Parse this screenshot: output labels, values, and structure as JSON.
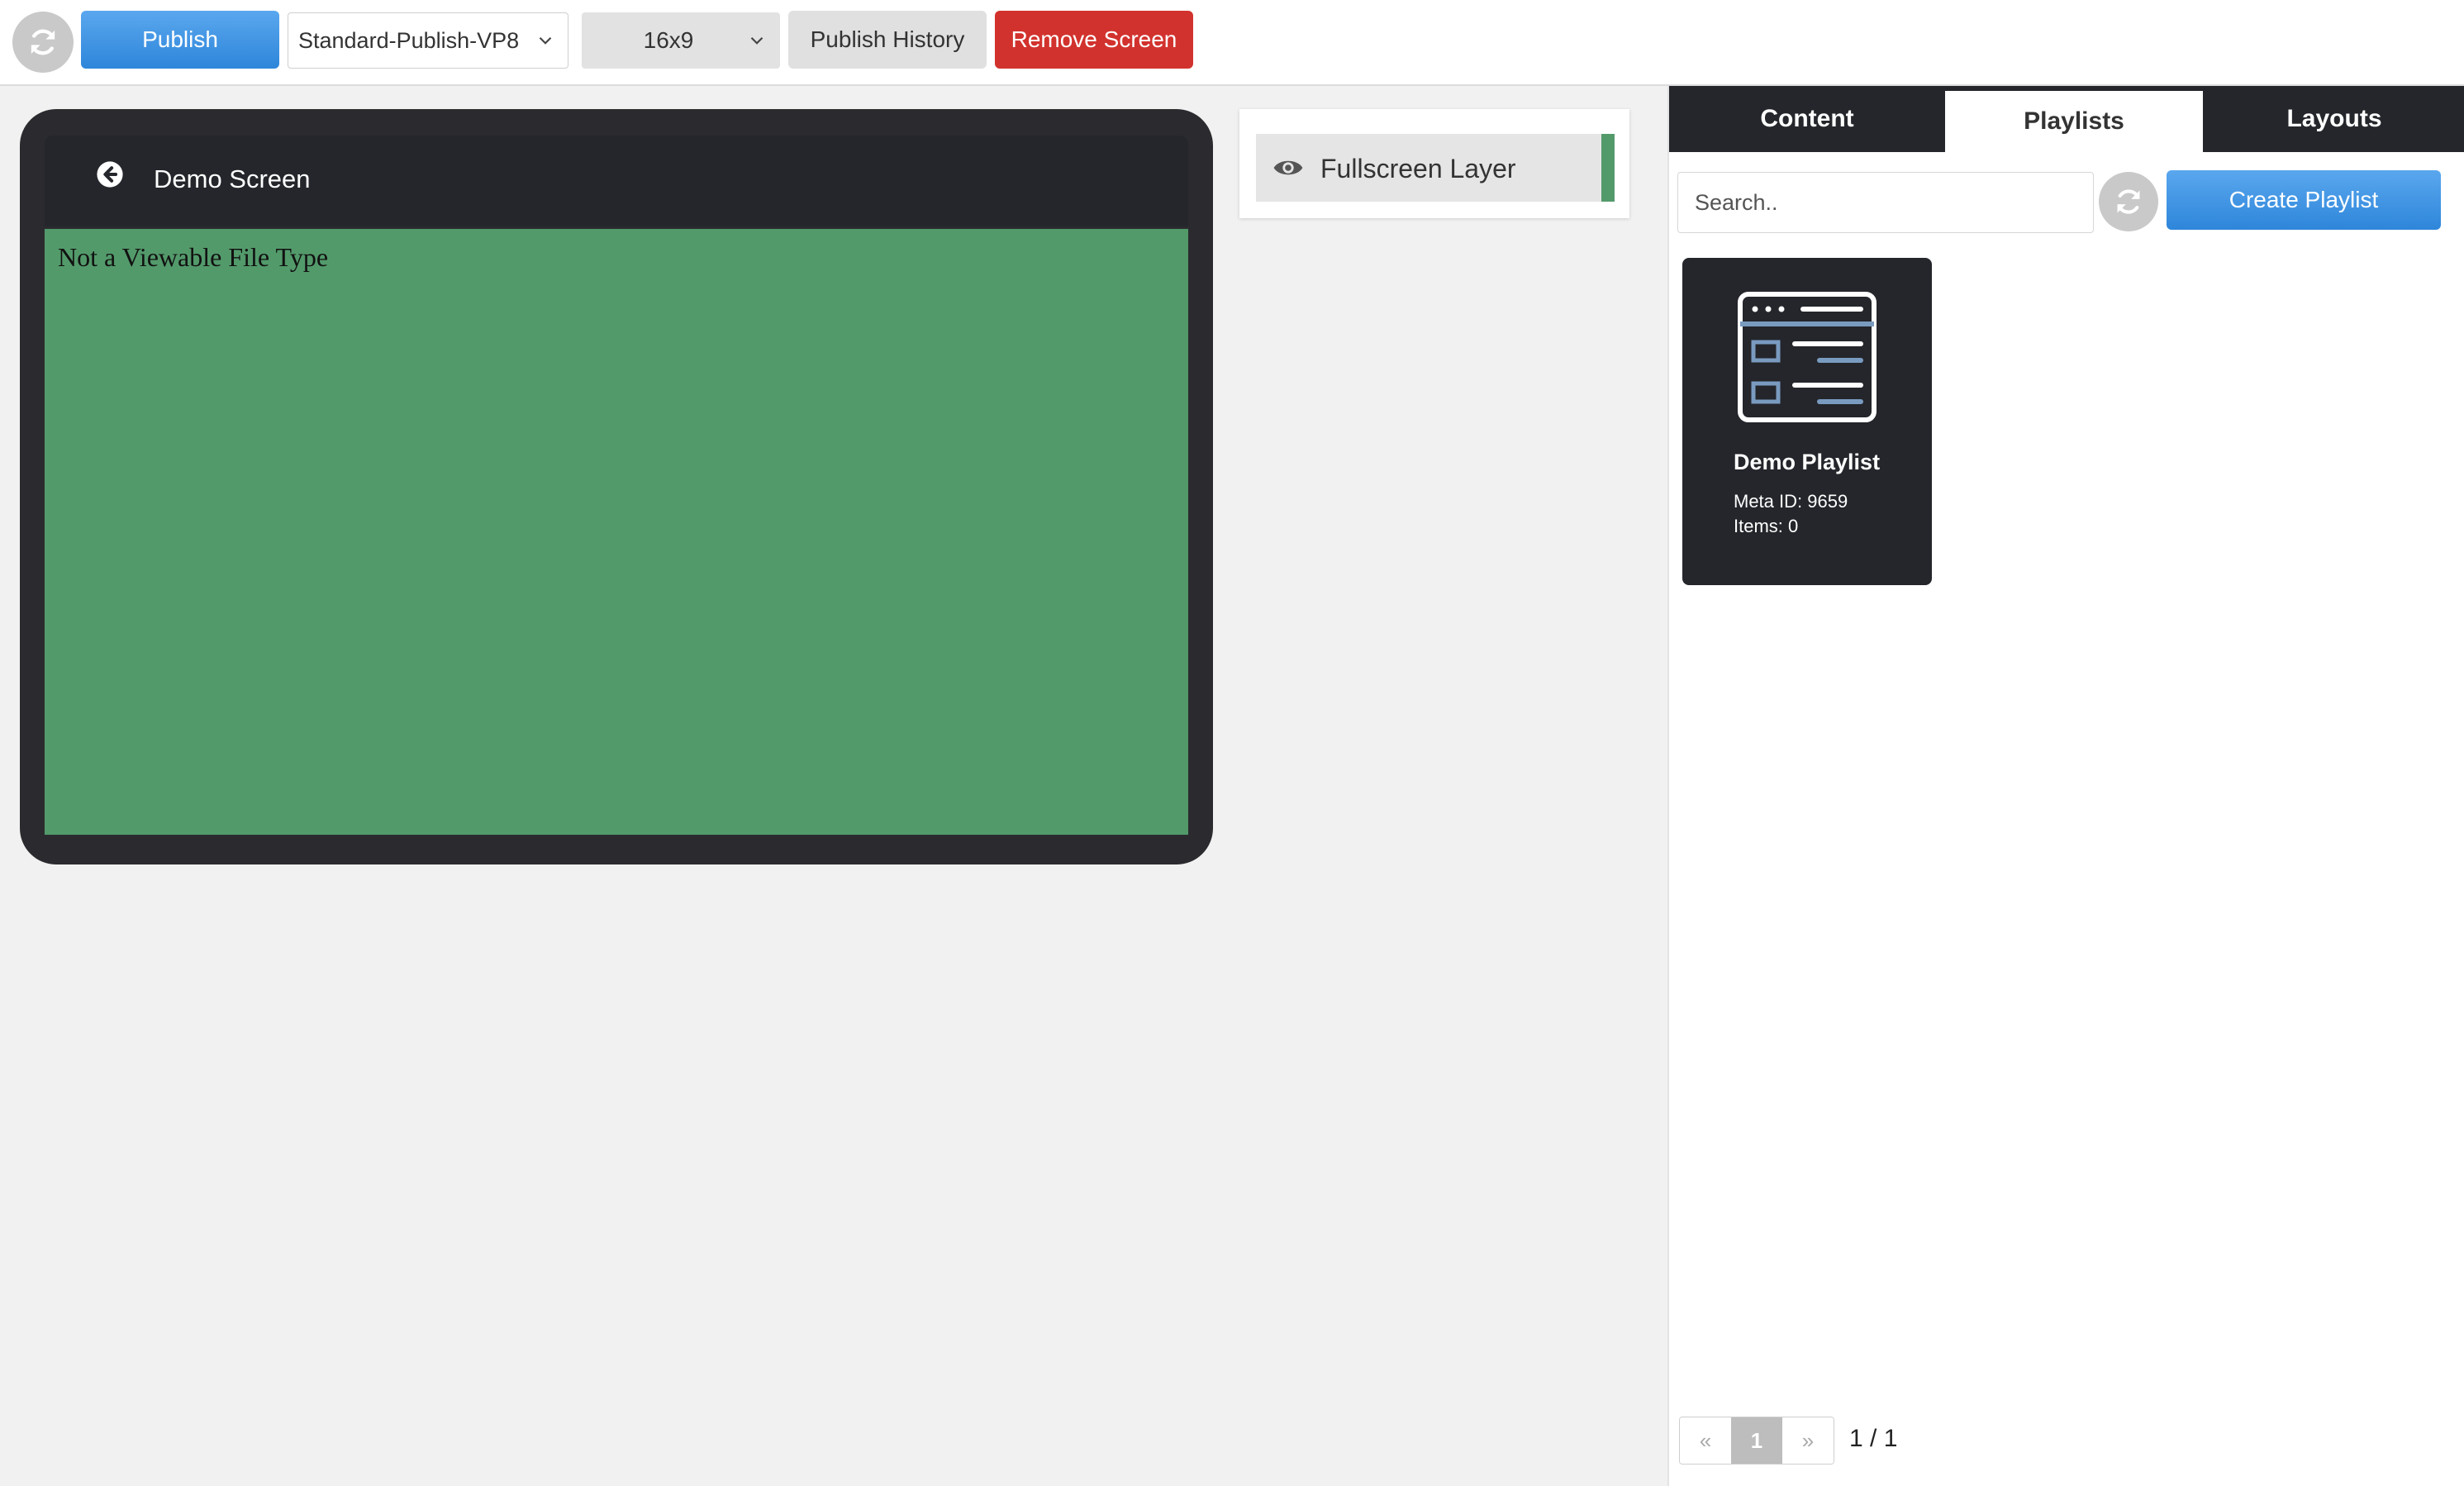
{
  "toolbar": {
    "publish_label": "Publish",
    "profile_select": "Standard-Publish-VP8",
    "ratio_select": "16x9",
    "history_label": "Publish History",
    "remove_label": "Remove Screen",
    "refresh_icon": "refresh-icon"
  },
  "preview": {
    "screen_title": "Demo Screen",
    "message": "Not a Viewable File Type",
    "background_color": "#539a6b"
  },
  "layers": {
    "items": [
      {
        "name": "Fullscreen Layer",
        "color": "#539a6b"
      }
    ]
  },
  "panel": {
    "tabs": [
      {
        "label": "Content"
      },
      {
        "label": "Playlists"
      },
      {
        "label": "Layouts"
      }
    ],
    "active_tab": "Playlists",
    "search_placeholder": "Search..",
    "create_label": "Create Playlist",
    "playlists": [
      {
        "name": "Demo Playlist",
        "meta": "Meta ID: 9659",
        "items": "Items: 0"
      }
    ],
    "pagination": {
      "prev": "«",
      "current": "1",
      "next": "»",
      "summary": "1 / 1"
    }
  }
}
